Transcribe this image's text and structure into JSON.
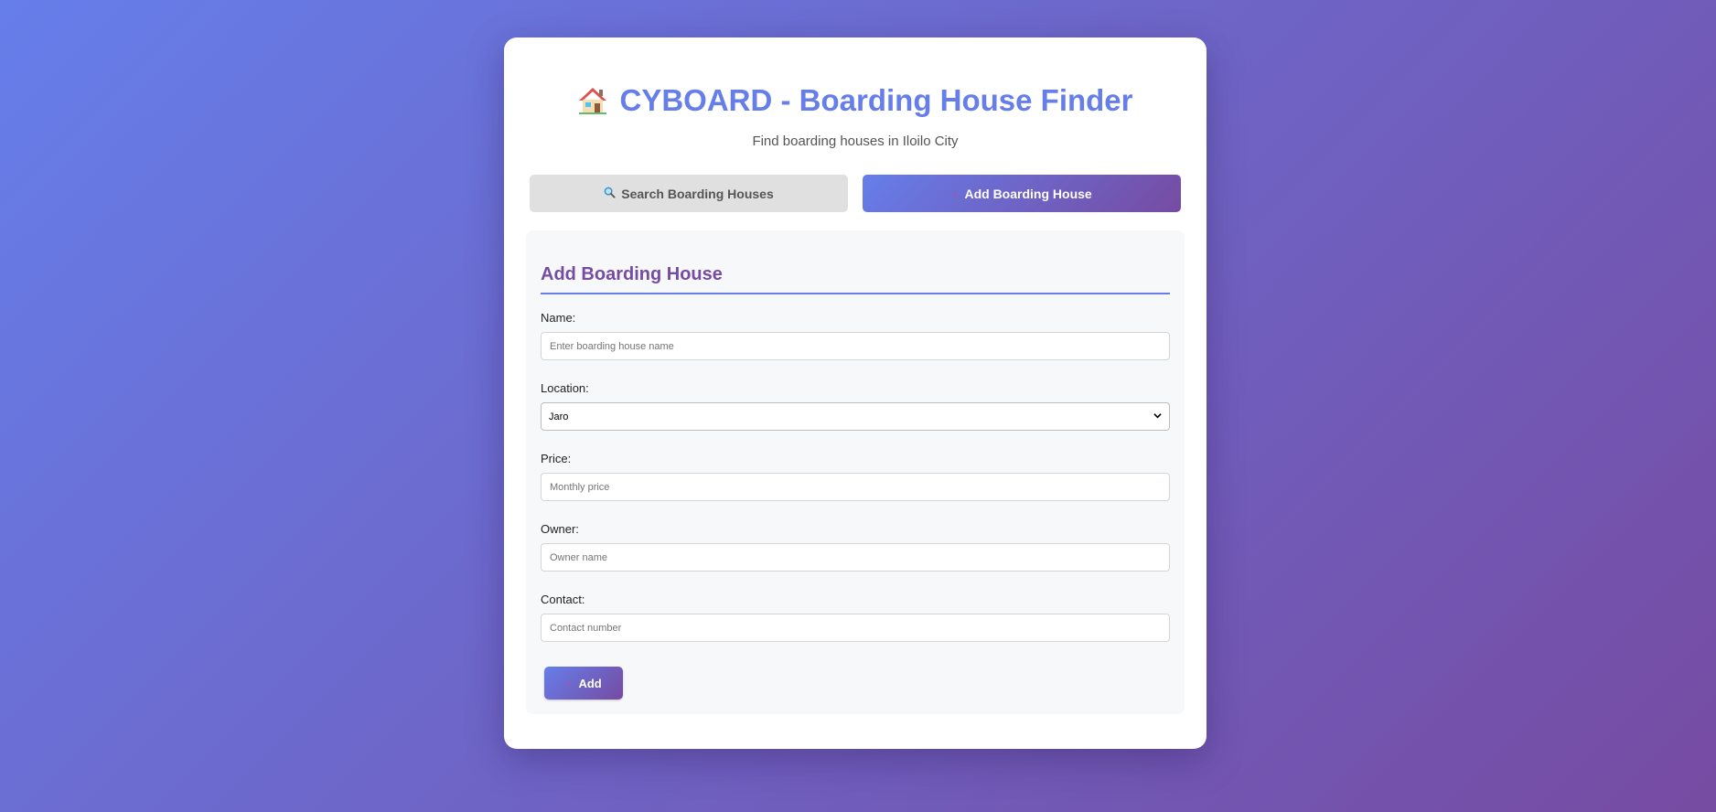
{
  "header": {
    "title": "CYBOARD - Boarding House Finder",
    "subtitle": "Find boarding houses in Iloilo City",
    "logo_icon": "house-emoji-icon"
  },
  "tabs": [
    {
      "label": "Search Boarding Houses",
      "icon": "magnifier-icon",
      "active": false
    },
    {
      "label": "Add Boarding House",
      "icon": "plus-icon",
      "active": true
    }
  ],
  "form": {
    "title": "Add Boarding House",
    "fields": {
      "name": {
        "label": "Name:",
        "placeholder": "Enter boarding house name",
        "value": ""
      },
      "location": {
        "label": "Location:",
        "selected": "Jaro"
      },
      "price": {
        "label": "Price:",
        "placeholder": "Monthly price",
        "value": ""
      },
      "owner": {
        "label": "Owner:",
        "placeholder": "Owner name",
        "value": ""
      },
      "contact": {
        "label": "Contact:",
        "placeholder": "Contact number",
        "value": ""
      }
    },
    "submit_label": "Add",
    "plus_glyph": "+"
  },
  "colors": {
    "accent": "#667eea",
    "accent_dark": "#764ba2",
    "tab_inactive": "#e0e0e0",
    "panel_bg": "#f7f8fa"
  }
}
